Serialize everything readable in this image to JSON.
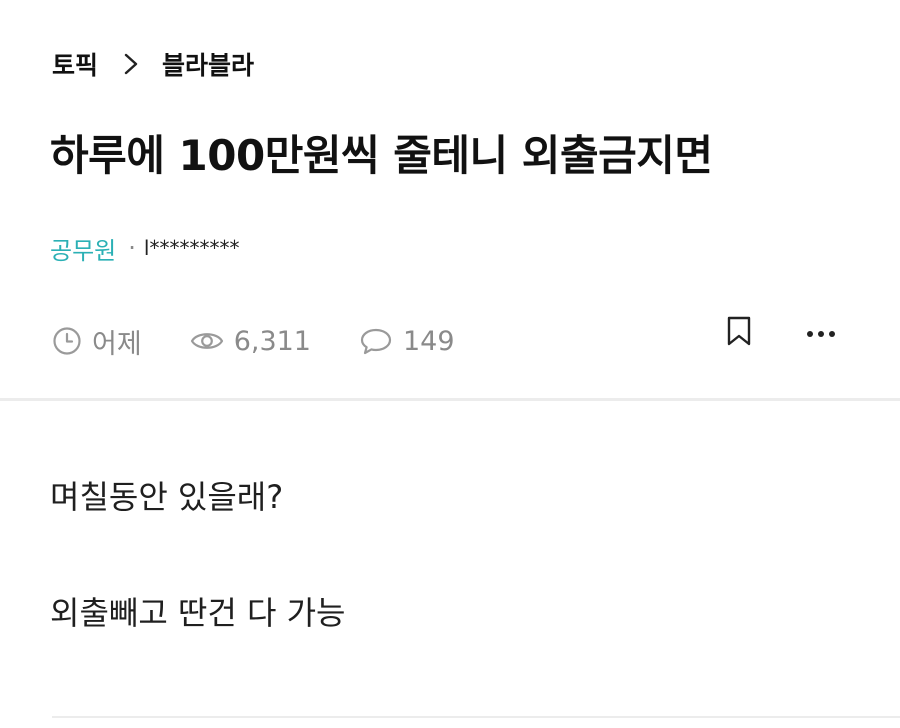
{
  "breadcrumb": {
    "topic": "토픽",
    "separator_icon": "chevron-right-icon",
    "board": "블라블라"
  },
  "post": {
    "title": "하루에 100만원씩 줄테니 외출금지면",
    "author_company": "공무원",
    "author_separator": "·",
    "author_nickname": "l*********",
    "stats": {
      "time": "어제",
      "views": "6,311",
      "comments": "149"
    },
    "body": [
      "며칠동안 있을래?",
      "외출빼고 딴건 다 가능"
    ]
  },
  "icons": {
    "time": "clock-icon",
    "views": "eye-icon",
    "comments": "comment-icon",
    "bookmark": "bookmark-icon",
    "more": "more-icon"
  },
  "colors": {
    "company": "#2bb0b5",
    "meta": "#8a8a8a",
    "text": "#111111"
  }
}
